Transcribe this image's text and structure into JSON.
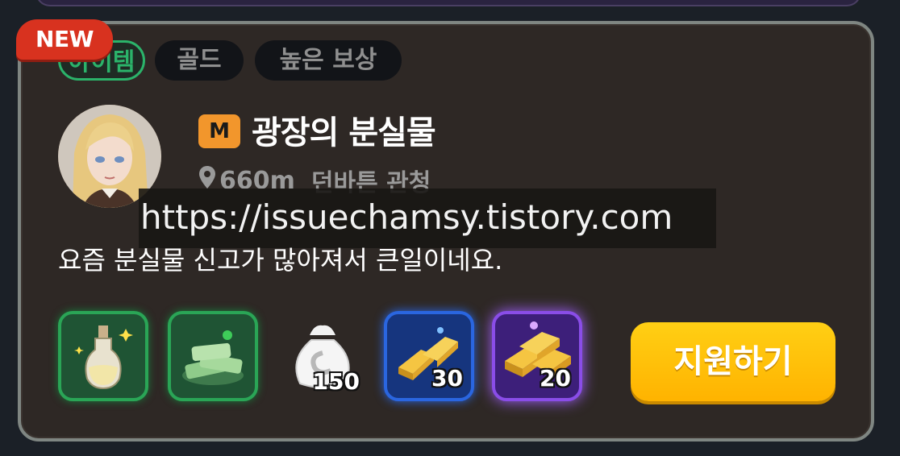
{
  "badge": {
    "new": "NEW"
  },
  "tags": {
    "item": "아이템",
    "gold": "골드",
    "high_reward": "높은 보상"
  },
  "quest": {
    "grade": "M",
    "title": "광장의 분실물",
    "distance": "660m",
    "location": "던바튼 관청",
    "description": "요즘 분실물 신고가 많아져서 큰일이네요."
  },
  "watermark": "https://issuechamsy.tistory.com",
  "rewards": {
    "potion_icon": "potion-icon",
    "cash_icon": "cash-pile-icon",
    "bag_qty": "150",
    "gold_bar_qty": "30",
    "gold_stack_qty": "20"
  },
  "actions": {
    "apply": "지원하기"
  },
  "colors": {
    "new": "#d8321f",
    "tag_item": "#2bb36a",
    "grade": "#f2962c",
    "apply": "#ffc107"
  }
}
